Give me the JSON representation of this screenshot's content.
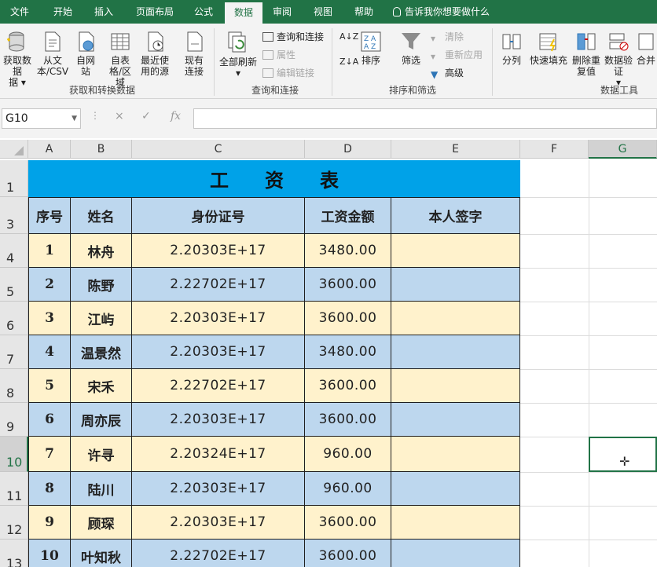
{
  "ribbon_tabs": [
    "文件",
    "开始",
    "插入",
    "页面布局",
    "公式",
    "数据",
    "审阅",
    "视图",
    "帮助"
  ],
  "active_tab": "数据",
  "tell_me": "告诉我你想要做什么",
  "groups": {
    "get_transform": {
      "label": "获取和转换数据",
      "buttons": [
        "获取数据",
        "据",
        "从文本/CSV",
        "自网站",
        "自表格/区域",
        "最近使用的源",
        "现有连接"
      ]
    },
    "queries": {
      "label": "查询和连接",
      "refresh_all": "全部刷新",
      "items": [
        "查询和连接",
        "属性",
        "编辑链接"
      ]
    },
    "sort_filter": {
      "label": "排序和筛选",
      "sort": "排序",
      "filter": "筛选",
      "items": [
        "清除",
        "重新应用",
        "高级"
      ]
    },
    "data_tools": {
      "label": "数据工具",
      "buttons": [
        "分列",
        "快速填充",
        "删除重复值",
        "数据验证",
        "合并"
      ]
    }
  },
  "name_box": "G10",
  "formula_icons": [
    "×",
    "✓",
    "fx"
  ],
  "columns": [
    "A",
    "B",
    "C",
    "D",
    "E",
    "F",
    "G"
  ],
  "selected_column": "G",
  "rows": [
    "1",
    "3",
    "4",
    "5",
    "6",
    "7",
    "8",
    "9",
    "10",
    "11",
    "12",
    "13"
  ],
  "selected_row": "10",
  "sheet": {
    "title": "工资表",
    "headers": [
      "序号",
      "姓名",
      "身份证号",
      "工资金额",
      "本人签字"
    ],
    "records": [
      [
        "1",
        "林舟",
        "2.20303E+17",
        "3480.00",
        ""
      ],
      [
        "2",
        "陈野",
        "2.22702E+17",
        "3600.00",
        ""
      ],
      [
        "3",
        "江屿",
        "2.20303E+17",
        "3600.00",
        ""
      ],
      [
        "4",
        "温景然",
        "2.20303E+17",
        "3480.00",
        ""
      ],
      [
        "5",
        "宋禾",
        "2.22702E+17",
        "3600.00",
        ""
      ],
      [
        "6",
        "周亦辰",
        "2.20303E+17",
        "3600.00",
        ""
      ],
      [
        "7",
        "许寻",
        "2.20324E+17",
        "960.00",
        ""
      ],
      [
        "8",
        "陆川",
        "2.20303E+17",
        "960.00",
        ""
      ],
      [
        "9",
        "顾琛",
        "2.20303E+17",
        "3600.00",
        ""
      ],
      [
        "10",
        "叶知秋",
        "2.22702E+17",
        "3600.00",
        ""
      ]
    ]
  },
  "colors": {
    "excel_green": "#217346",
    "title_fill": "#00a2e8",
    "header_fill": "#bdd7ee",
    "odd_row_fill": "#fff2cc",
    "even_row_fill": "#bdd7ee"
  }
}
